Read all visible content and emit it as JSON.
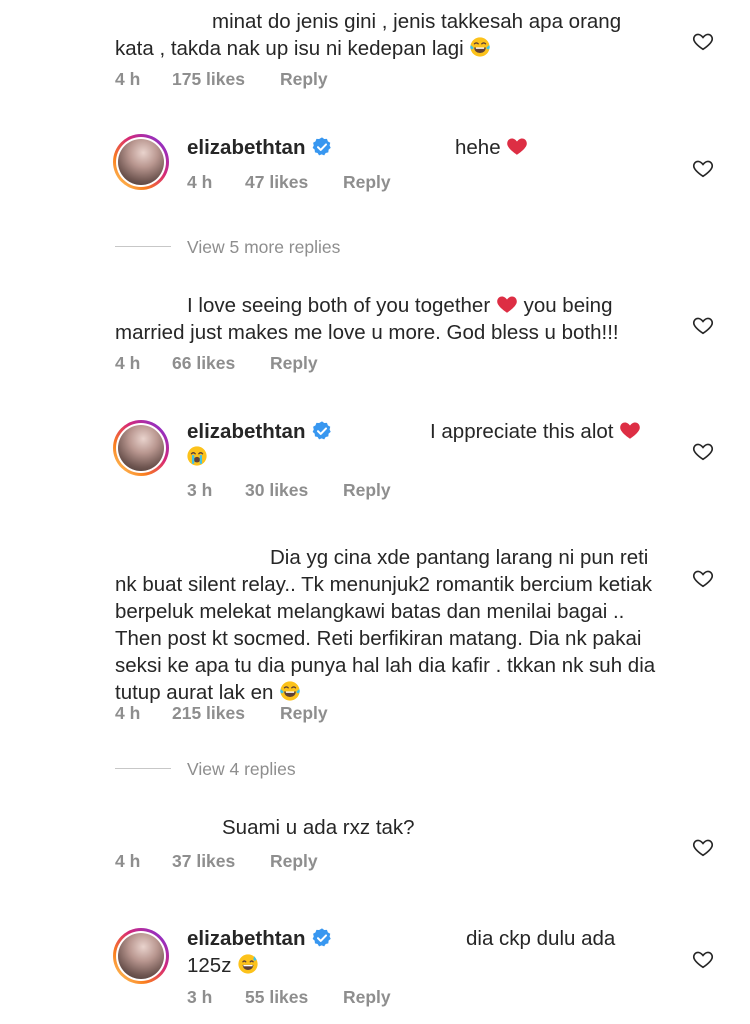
{
  "comments": [
    {
      "text_line1": "minat do jenis gini , jenis takkesah apa orang",
      "text_line2": "kata , takda nak up isu ni kedepan lagi",
      "emoji": "laughing-tears",
      "time": "4 h",
      "likes": "175 likes",
      "reply": "Reply"
    },
    {
      "username": "elizabethtan",
      "text": "hehe",
      "emoji": "red-heart",
      "time": "4 h",
      "likes": "47 likes",
      "reply": "Reply"
    },
    {
      "view_more": "View 5 more replies"
    },
    {
      "text_line1": "I love seeing both of you together",
      "text_line1_after": "you being",
      "text_line2": "married just makes me love u more. God bless u both!!!",
      "emoji": "red-heart",
      "time": "4 h",
      "likes": "66 likes",
      "reply": "Reply"
    },
    {
      "username": "elizabethtan",
      "text": "I appreciate this alot",
      "emoji": "red-heart",
      "emoji2": "crying-face",
      "time": "3 h",
      "likes": "30 likes",
      "reply": "Reply"
    },
    {
      "lines": [
        "Dia yg cina xde pantang larang ni pun reti",
        "nk buat silent relay.. Tk menunjuk2 romantik bercium ketiak",
        "berpeluk melekat melangkawi batas dan menilai bagai ..",
        "Then post kt socmed. Reti berfikiran matang.  Dia nk pakai",
        "seksi ke apa tu dia punya hal lah dia kafir . tkkan nk suh dia",
        "tutup aurat lak en"
      ],
      "emoji": "laughing-tears",
      "time": "4 h",
      "likes": "215 likes",
      "reply": "Reply"
    },
    {
      "view_more": "View 4 replies"
    },
    {
      "text": "Suami u ada rxz tak?",
      "time": "4 h",
      "likes": "37 likes",
      "reply": "Reply"
    },
    {
      "username": "elizabethtan",
      "text_line1": "dia ckp dulu ada",
      "text_line2": "125z",
      "emoji": "grinning-sweat",
      "time": "3 h",
      "likes": "55 likes",
      "reply": "Reply"
    }
  ],
  "icons": {
    "like": "heart-outline-icon",
    "verified": "verified-badge-icon"
  },
  "colors": {
    "text": "#262626",
    "meta": "#8e8e8e",
    "verified": "#3897f0",
    "heart": "#ed4956"
  }
}
